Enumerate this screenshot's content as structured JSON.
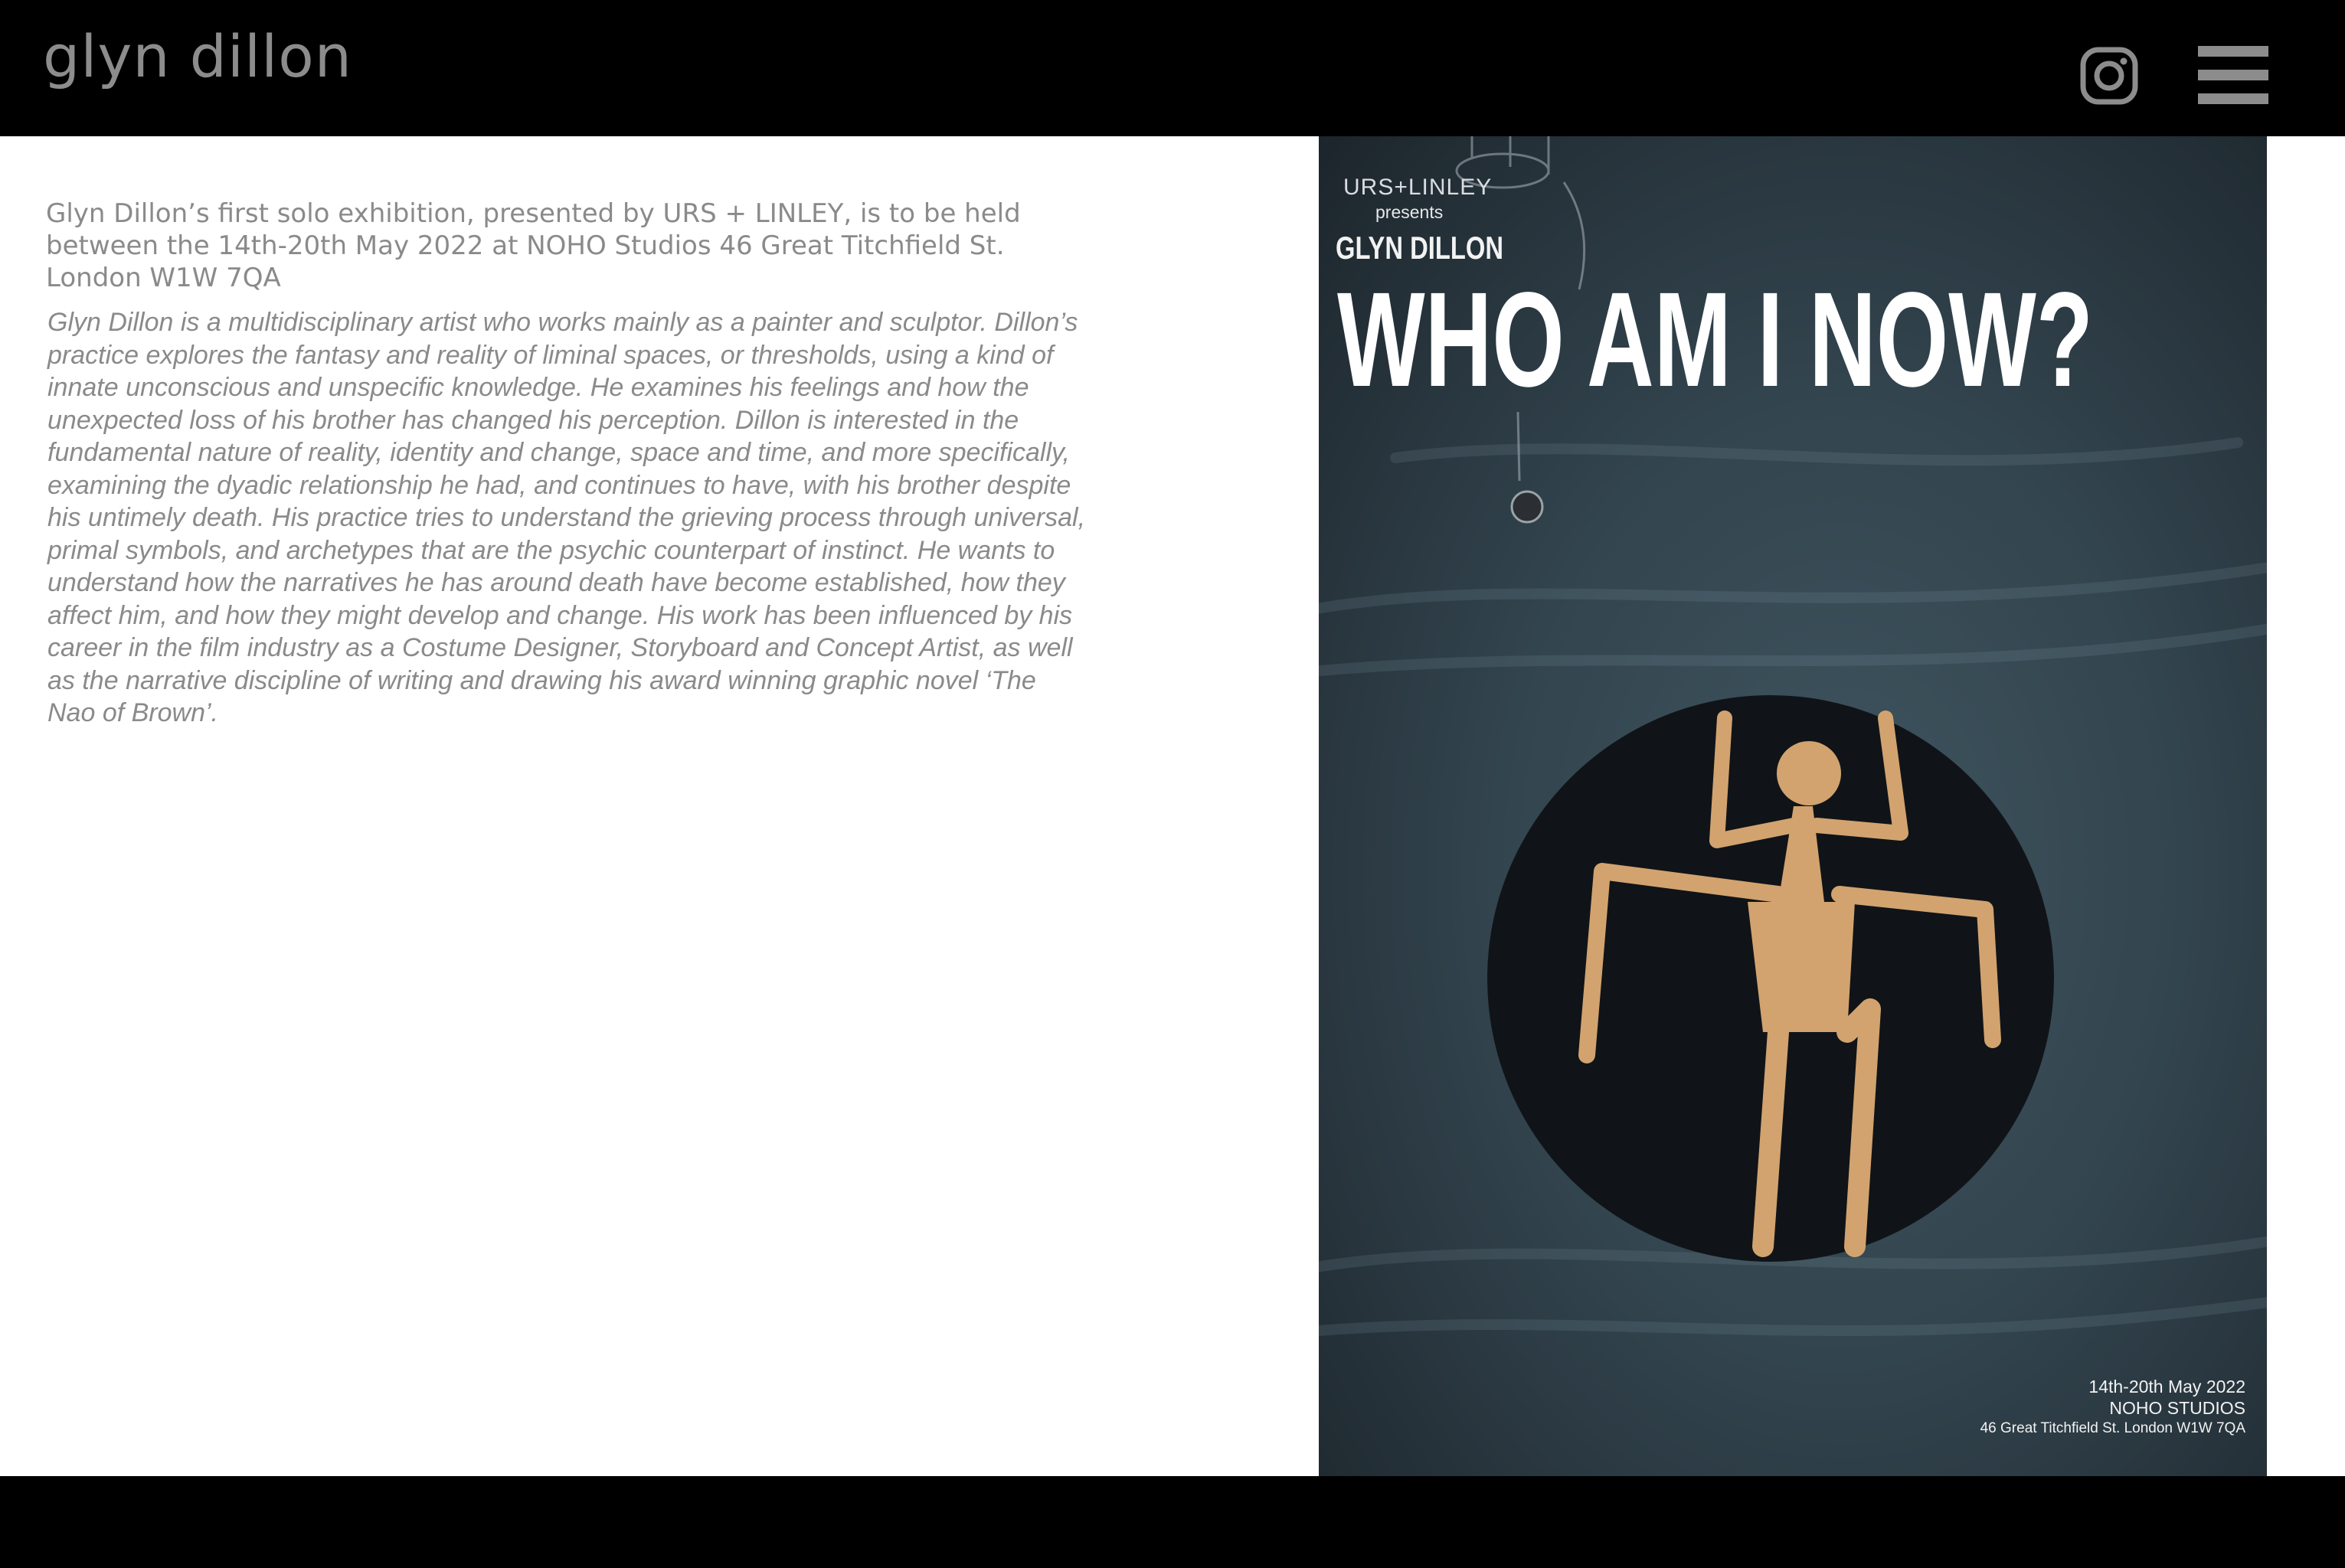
{
  "header": {
    "brand": "glyn dillon",
    "instagram_icon": "instagram-icon",
    "menu_icon": "hamburger-menu-icon"
  },
  "main": {
    "intro": "Glyn Dillon’s first solo exhibition, presented by URS + LINLEY, is to be held between the 14th-20th May 2022 at NOHO Studios 46 Great Titchfield St. London W1W 7QA",
    "bio": "Glyn Dillon is a multidisciplinary artist who works mainly as a painter and sculptor. Dillon’s practice explores the fantasy and reality of liminal spaces, or thresholds, using a kind of innate unconscious and unspecific knowledge. He examines his feelings and how the unexpected loss of his brother has changed his perception. Dillon is interested in the fundamental nature of reality, identity and change, space and time, and more specifically, examining the dyadic relationship he had, and continues to have, with his brother despite his untimely death. His practice tries to understand the grieving process through universal, primal symbols, and archetypes that are the psychic counterpart of instinct. He wants to understand how the narratives he has around death have become established, how they affect him, and how they might develop and change. His work has been influenced by his career in the film industry as a Costume Designer, Storyboard and Concept Artist, as well as the narrative discipline of writing and drawing his award winning graphic novel ‘The Nao of Brown’."
  },
  "poster": {
    "presenter": "URS+LINLEY",
    "presents": "presents",
    "artist": "GLYN DILLON",
    "title": "WHO AM I NOW?",
    "dates": "14th-20th May 2022",
    "venue": "NOHO STUDIOS",
    "address": "46 Great Titchfield St. London W1W 7QA"
  },
  "colors": {
    "header_bg": "#000000",
    "text_grey": "#8a8a8a",
    "poster_bg": "#33454f",
    "figure": "#d2a36f"
  }
}
